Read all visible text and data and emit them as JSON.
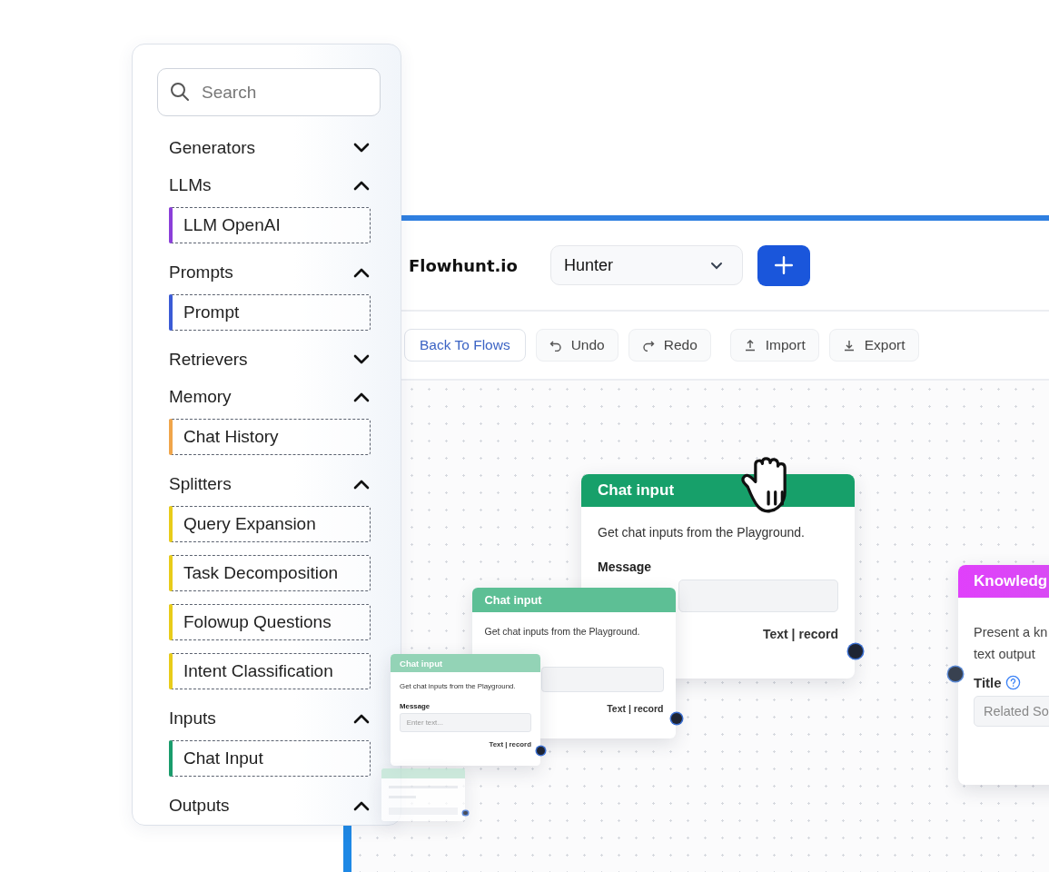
{
  "sidebar": {
    "search": {
      "placeholder": "Search"
    },
    "categories": [
      {
        "label": "Generators",
        "expanded": false
      },
      {
        "label": "LLMs",
        "expanded": true,
        "items": [
          {
            "label": "LLM OpenAI",
            "color": "#8b3fd9"
          }
        ]
      },
      {
        "label": "Prompts",
        "expanded": true,
        "items": [
          {
            "label": "Prompt",
            "color": "#3b5bd6"
          }
        ]
      },
      {
        "label": "Retrievers",
        "expanded": false
      },
      {
        "label": "Memory",
        "expanded": true,
        "items": [
          {
            "label": "Chat History",
            "color": "#f0a54a"
          }
        ]
      },
      {
        "label": "Splitters",
        "expanded": true,
        "items": [
          {
            "label": "Query Expansion",
            "color": "#e8cc1a"
          },
          {
            "label": "Task Decomposition",
            "color": "#e8cc1a"
          },
          {
            "label": "Folowup Questions",
            "color": "#e8cc1a"
          },
          {
            "label": "Intent Classification",
            "color": "#e8cc1a"
          }
        ]
      },
      {
        "label": "Inputs",
        "expanded": true,
        "items": [
          {
            "label": "Chat Input",
            "color": "#1a9c6c"
          }
        ]
      },
      {
        "label": "Outputs",
        "expanded": true
      }
    ]
  },
  "editor": {
    "brand": "Flowhunt.io",
    "project_select": {
      "value": "Hunter"
    },
    "toolbar": [
      {
        "label": "Back To Flows",
        "kind": "link"
      },
      {
        "label": "Undo",
        "kind": "undo"
      },
      {
        "label": "Redo",
        "kind": "redo"
      },
      {
        "label": "Import",
        "kind": "import"
      },
      {
        "label": "Export",
        "kind": "export"
      }
    ],
    "nodes": [
      {
        "kind": "chat",
        "title": "Chat input",
        "description": "Get chat inputs from the Playground.",
        "field_label": "Message",
        "output": "Text | record"
      },
      {
        "kind": "chat",
        "title": "Chat input",
        "description": "Get chat inputs from the Playground.",
        "output": "Text | record"
      },
      {
        "kind": "chat",
        "title": "Chat input",
        "description": "Get chat inputs from the Playground.",
        "field_label": "Message",
        "placeholder": "Enter text...",
        "output": "Text | record"
      },
      {
        "kind": "ghost"
      },
      {
        "kind": "knowledge",
        "title": "Knowledg",
        "description_lines": [
          "Present a kn",
          "text output"
        ],
        "field_label": "Title",
        "placeholder": "Related So"
      }
    ]
  }
}
